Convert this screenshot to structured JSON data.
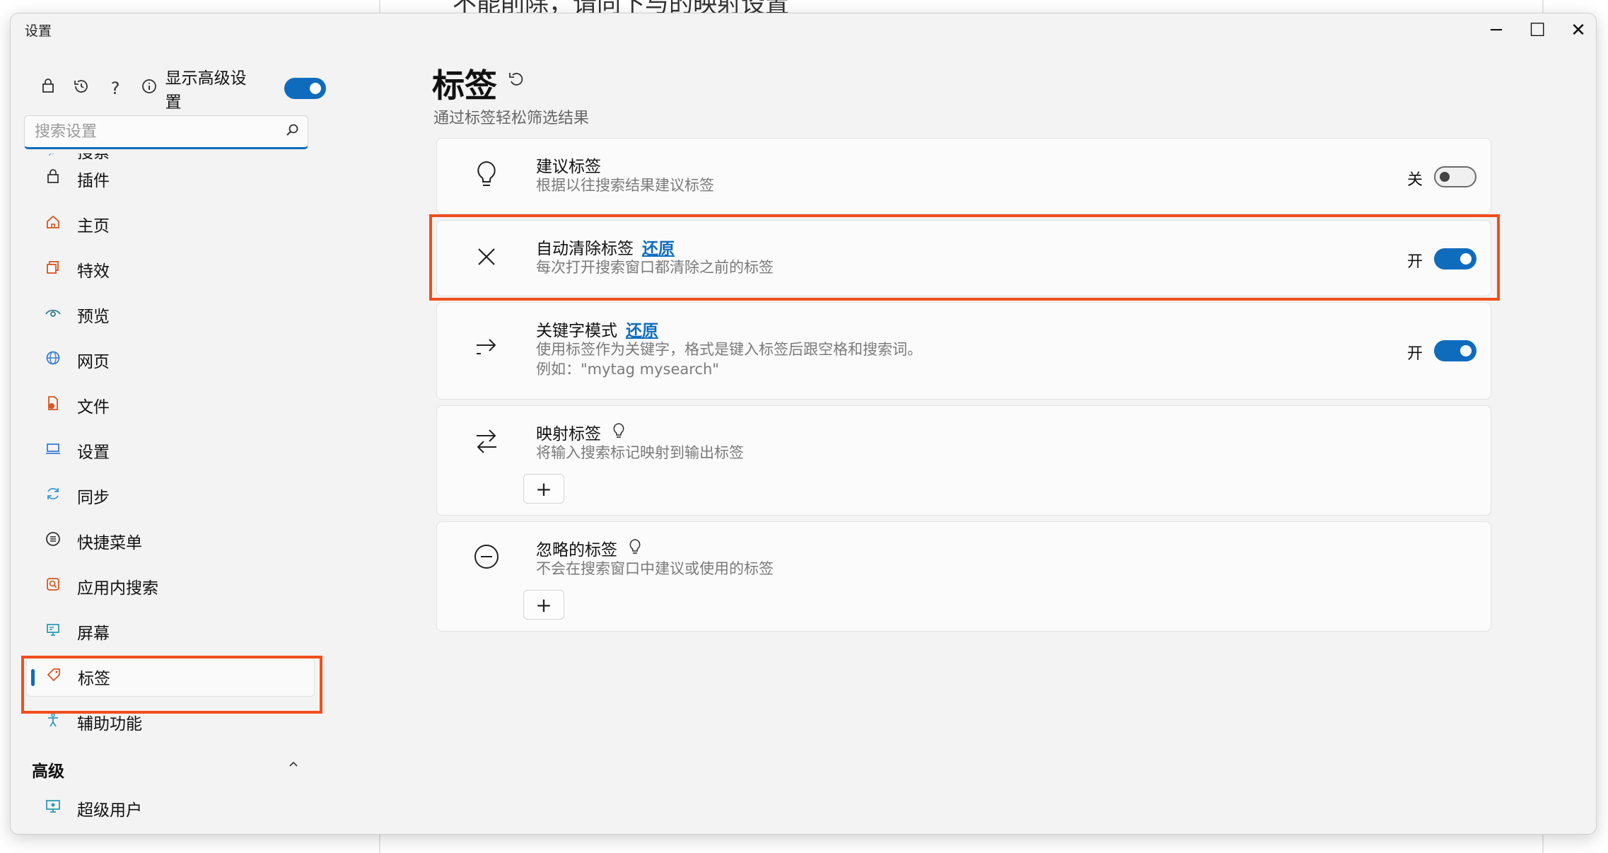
{
  "background": {
    "doc_text": "不能削除，请同下与的映射设置"
  },
  "window": {
    "title": "设置",
    "minimize_glyph": "─",
    "maximize_glyph": "☐",
    "close_glyph": "✕"
  },
  "sidebar": {
    "top_icons": [
      "bag-icon",
      "history-icon",
      "help-icon",
      "info-icon"
    ],
    "advanced_label": "显示高级设置",
    "advanced_on": true,
    "search_placeholder": "搜索设置",
    "partial_item": "搜索",
    "items": [
      {
        "label": "插件",
        "icon": "plugin-icon",
        "color": "#333333"
      },
      {
        "label": "主页",
        "icon": "home-icon",
        "color": "#d9541e"
      },
      {
        "label": "特效",
        "icon": "effects-icon",
        "color": "#d9541e"
      },
      {
        "label": "预览",
        "icon": "eye-icon",
        "color": "#2f7d8c"
      },
      {
        "label": "网页",
        "icon": "globe-icon",
        "color": "#3a7bd5"
      },
      {
        "label": "文件",
        "icon": "file-icon",
        "color": "#d9541e"
      },
      {
        "label": "设置",
        "icon": "laptop-icon",
        "color": "#3a7bd5"
      },
      {
        "label": "同步",
        "icon": "sync-icon",
        "color": "#3a9bd5"
      },
      {
        "label": "快捷菜单",
        "icon": "menu-icon",
        "color": "#333333"
      },
      {
        "label": "应用内搜索",
        "icon": "app-search-icon",
        "color": "#d9541e"
      },
      {
        "label": "屏幕",
        "icon": "screen-icon",
        "color": "#2f9bb5"
      },
      {
        "label": "标签",
        "icon": "tag-icon",
        "color": "#d9541e",
        "selected": true
      },
      {
        "label": "辅助功能",
        "icon": "accessibility-icon",
        "color": "#2f9bb5"
      }
    ],
    "group_label": "高级",
    "group_item": {
      "label": "超级用户",
      "icon": "superuser-icon",
      "color": "#2f9bb5"
    }
  },
  "main": {
    "title": "标签",
    "subtitle": "通过标签轻松筛选结果",
    "cards": [
      {
        "title": "建议标签",
        "desc": "根据以往搜索结果建议标签",
        "state": "关",
        "on": false,
        "icon": "bulb-icon"
      },
      {
        "title": "自动清除标签",
        "restore": "还原",
        "desc": "每次打开搜索窗口都清除之前的标签",
        "state": "开",
        "on": true,
        "icon": "close-x-icon"
      },
      {
        "title": "关键字模式",
        "restore": "还原",
        "desc": "使用标签作为关键字，格式是键入标签后跟空格和搜索词。",
        "desc2": "例如：\"mytag mysearch\"",
        "state": "开",
        "on": true,
        "icon": "arrow-right-icon"
      },
      {
        "title": "映射标签",
        "desc": "将输入搜索标记映射到输出标签",
        "icon": "swap-icon",
        "add": "+"
      },
      {
        "title": "忽略的标签",
        "desc": "不会在搜索窗口中建议或使用的标签",
        "icon": "minus-circle-icon",
        "add": "+"
      }
    ]
  },
  "highlight_color": "#f24e1e",
  "accent_color": "#0f6cbd"
}
